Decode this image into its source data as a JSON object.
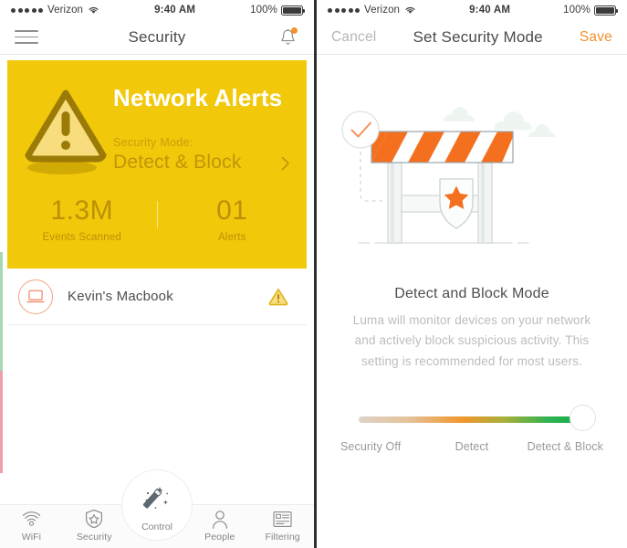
{
  "status_bar": {
    "carrier": "Verizon",
    "signal_dots": 5,
    "wifi_icon": "wifi-icon",
    "time": "9:40 AM",
    "battery_percent": "100%",
    "battery_icon": "battery-full-icon"
  },
  "left_panel": {
    "nav": {
      "menu_icon": "hamburger-menu-icon",
      "title": "Security",
      "bell_icon": "notification-bell-icon",
      "bell_has_badge": true
    },
    "alert_card": {
      "icon": "warning-triangle-icon",
      "title": "Network Alerts",
      "mode_label": "Security Mode:",
      "mode_value": "Detect & Block",
      "chevron_icon": "chevron-right-icon",
      "background_color": "#f2c80a",
      "stats": [
        {
          "value": "1.3M",
          "label": "Events Scanned"
        },
        {
          "value": "01",
          "label": "Alerts"
        }
      ]
    },
    "devices": [
      {
        "avatar_icon": "laptop-icon",
        "name": "Kevin's Macbook",
        "status_icon": "warning-triangle-icon"
      }
    ],
    "tabbar": [
      {
        "icon": "wifi-icon",
        "label": "WiFi"
      },
      {
        "icon": "shield-star-icon",
        "label": "Security"
      },
      {
        "icon": "magic-wand-icon",
        "label": "Control",
        "center": true
      },
      {
        "icon": "person-icon",
        "label": "People"
      },
      {
        "icon": "filter-list-icon",
        "label": "Filtering"
      }
    ]
  },
  "right_panel": {
    "nav": {
      "cancel_label": "Cancel",
      "title": "Set Security Mode",
      "save_label": "Save",
      "save_color": "#f0932f"
    },
    "illustration": {
      "name": "roadblock-barricade-illustration",
      "checkmark_icon": "check-circle-icon",
      "shield_icon": "shield-star-icon",
      "cloud_icon": "cloud-icon",
      "barrier_color": "#f4701f"
    },
    "mode_title": "Detect and Block Mode",
    "mode_description": "Luma will monitor devices on your network and actively block suspicious activity. This setting is recommended for most users.",
    "slider": {
      "value_index": 2,
      "options": [
        "Security Off",
        "Detect",
        "Detect & Block"
      ],
      "gradient_from": "#ddd2c6",
      "gradient_mid": "#f0962c",
      "gradient_to": "#13ae4c"
    }
  }
}
